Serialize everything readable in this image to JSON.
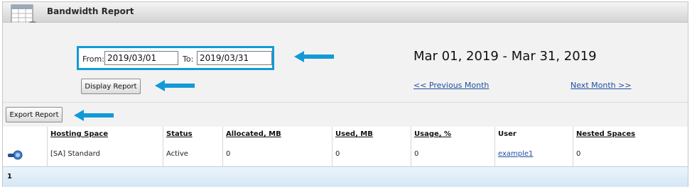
{
  "header": {
    "title": "Bandwidth Report",
    "icon": "report-magnifier-icon"
  },
  "filter": {
    "from_label": "From:",
    "from_value": "2019/03/01",
    "to_label": "To:",
    "to_value": "2019/03/31",
    "display_button": "Display Report",
    "date_range": "Mar 01, 2019 - Mar 31, 2019",
    "prev_link": "<< Previous Month",
    "next_link": "Next Month >>"
  },
  "toolbar": {
    "export_button": "Export Report"
  },
  "table": {
    "columns": [
      "",
      "Hosting Space",
      "Status",
      "Allocated, MB",
      "Used, MB",
      "Usage, %",
      "User",
      "Nested Spaces"
    ],
    "rows": [
      {
        "icon": "hosting-space-icon",
        "space": "[SA] Standard",
        "status": "Active",
        "allocated": "0",
        "used": "0",
        "usage": "0",
        "user": "example1",
        "nested": "0"
      }
    ]
  },
  "pager": {
    "current_page": "1"
  },
  "colors": {
    "highlight": "#129ad8",
    "arrow": "#129ad8",
    "link": "#1f4fa0"
  }
}
